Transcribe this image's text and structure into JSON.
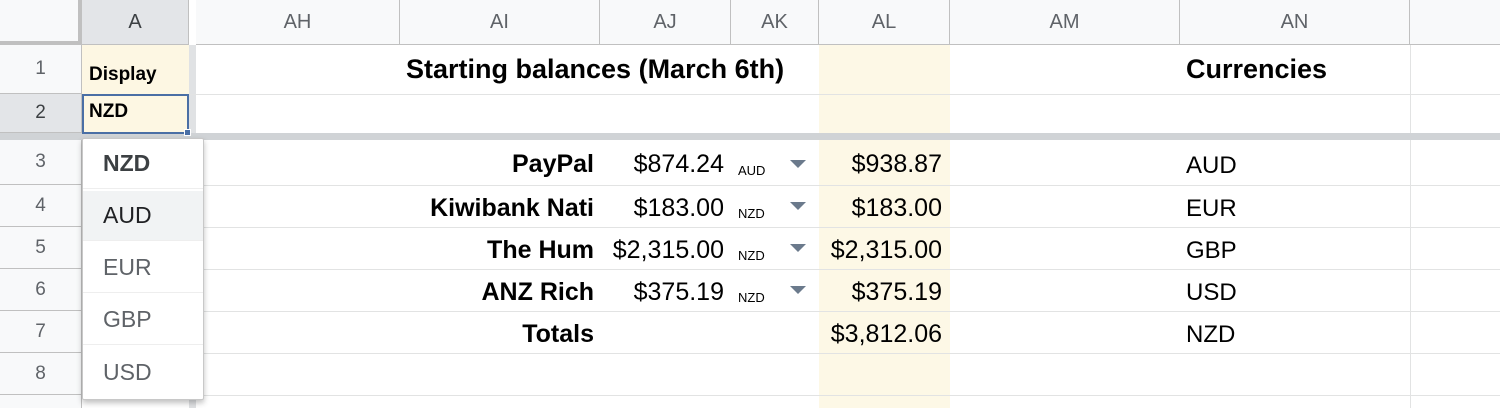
{
  "columns": [
    {
      "id": "A",
      "selected": true
    },
    {
      "id": "AH"
    },
    {
      "id": "AI"
    },
    {
      "id": "AJ"
    },
    {
      "id": "AK"
    },
    {
      "id": "AL"
    },
    {
      "id": "AM"
    },
    {
      "id": "AN"
    }
  ],
  "rows": [
    "1",
    "2",
    "3",
    "4",
    "5",
    "6",
    "7",
    "8"
  ],
  "cells": {
    "a1": "Display",
    "a2": "NZD",
    "title": "Starting balances (March 6th)",
    "currencies_title": "Currencies"
  },
  "accounts": [
    {
      "name": "PayPal",
      "amount": "$874.24",
      "currency": "AUD",
      "converted": "$938.87"
    },
    {
      "name": "Kiwibank Nati",
      "amount": "$183.00",
      "currency": "NZD",
      "converted": "$183.00"
    },
    {
      "name": "The Hum",
      "amount": "$2,315.00",
      "currency": "NZD",
      "converted": "$2,315.00"
    },
    {
      "name": "ANZ Rich",
      "amount": "$375.19",
      "currency": "NZD",
      "converted": "$375.19"
    }
  ],
  "totals": {
    "label": "Totals",
    "value": "$3,812.06"
  },
  "currency_list": [
    "AUD",
    "EUR",
    "GBP",
    "USD",
    "NZD"
  ],
  "dropdown": {
    "options": [
      "NZD",
      "AUD",
      "EUR",
      "GBP",
      "USD"
    ],
    "selected": "NZD",
    "hovered": "AUD"
  },
  "colors": {
    "selection_border": "#4a6fa5",
    "highlight_fill": "#fdf7e3"
  },
  "icons": {
    "dropdown_arrow": "triangle-down"
  }
}
